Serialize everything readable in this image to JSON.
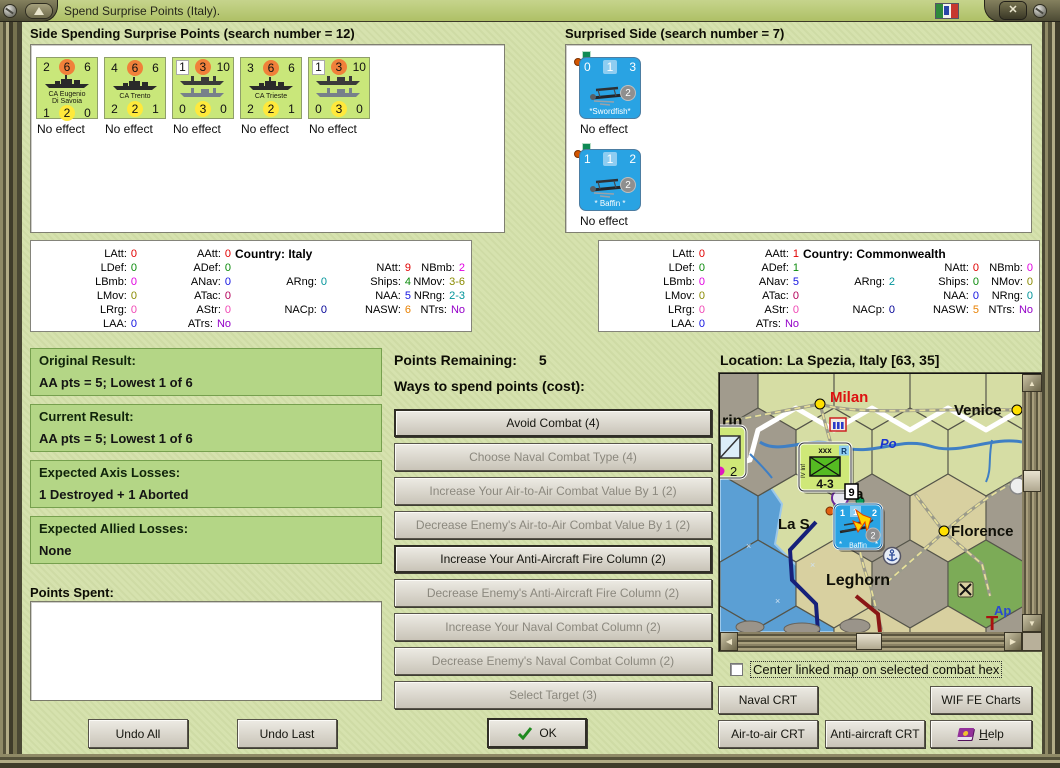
{
  "window": {
    "title": "Spend Surprise Points (Italy).",
    "close_glyph": "✕",
    "flag": "italy-flag"
  },
  "left_panel": {
    "heading": "Side Spending Surprise Points (search number = 12)",
    "units": [
      {
        "type": "ship",
        "name1": "CA Eugenio",
        "name2": "Di Savoia",
        "t1": "2",
        "t2": "6",
        "t3": "6",
        "b1": "1",
        "b2": "2",
        "b3": "0",
        "t1box": false,
        "effect": "No effect"
      },
      {
        "type": "ship",
        "name1": "CA Trento",
        "name2": "",
        "t1": "4",
        "t2": "6",
        "t3": "6",
        "b1": "2",
        "b2": "2",
        "b3": "1",
        "t1box": false,
        "effect": "No effect"
      },
      {
        "type": "convoy",
        "name1": "",
        "name2": "",
        "t1": "1",
        "t2": "3",
        "t3": "10",
        "b1": "0",
        "b2": "3",
        "b3": "0",
        "t1box": true,
        "effect": "No effect"
      },
      {
        "type": "ship",
        "name1": "CA Trieste",
        "name2": "",
        "t1": "3",
        "t2": "6",
        "t3": "6",
        "b1": "2",
        "b2": "2",
        "b3": "1",
        "t1box": false,
        "effect": "No effect"
      },
      {
        "type": "convoy",
        "name1": "",
        "name2": "",
        "t1": "1",
        "t2": "3",
        "t3": "10",
        "b1": "0",
        "b2": "3",
        "b3": "0",
        "t1box": true,
        "effect": "No effect"
      }
    ]
  },
  "right_panel": {
    "heading": "Surprised Side (search number = 7)",
    "units": [
      {
        "name": "*Swordfish*",
        "t1": "0",
        "t2": "1",
        "t3": "3",
        "circle": "2",
        "effect": "No effect"
      },
      {
        "name": "* Baffin *",
        "t1": "1",
        "t2": "1",
        "t3": "2",
        "circle": "2",
        "effect": "No effect"
      }
    ]
  },
  "stats_left": {
    "country": "Country: Italy",
    "land": [
      [
        "LAtt",
        "0",
        "red"
      ],
      [
        "LDef",
        "0",
        "green"
      ],
      [
        "LBmb",
        "0",
        "magenta"
      ],
      [
        "LMov",
        "0",
        "olive"
      ],
      [
        "LRrg",
        "0",
        "pink"
      ],
      [
        "LAA",
        "0",
        "blue"
      ]
    ],
    "air": [
      [
        "AAtt",
        "0",
        "red"
      ],
      [
        "ADef",
        "0",
        "green"
      ],
      [
        "ANav",
        "0",
        "blue"
      ],
      [
        "ATac",
        "0",
        "maroon"
      ],
      [
        "AStr",
        "0",
        "pink"
      ],
      [
        "ATrs",
        "No",
        "purple"
      ]
    ],
    "mid": [
      [
        "ARng",
        "0",
        "teal"
      ],
      [
        "NACp",
        "0",
        "navy"
      ]
    ],
    "nav1": [
      [
        "NAtt",
        "9",
        "red"
      ],
      [
        "Ships",
        "4",
        "green"
      ],
      [
        "NAA",
        "5",
        "blue"
      ],
      [
        "NASW",
        "6",
        "orange"
      ]
    ],
    "nav2": [
      [
        "NBmb",
        "2",
        "magenta"
      ],
      [
        "NMov",
        "3-6",
        "olive"
      ],
      [
        "NRng",
        "2-3",
        "teal"
      ],
      [
        "NTrs",
        "No",
        "purple"
      ]
    ]
  },
  "stats_right": {
    "country": "Country: Commonwealth",
    "land": [
      [
        "LAtt",
        "0",
        "red"
      ],
      [
        "LDef",
        "0",
        "green"
      ],
      [
        "LBmb",
        "0",
        "magenta"
      ],
      [
        "LMov",
        "0",
        "olive"
      ],
      [
        "LRrg",
        "0",
        "pink"
      ],
      [
        "LAA",
        "0",
        "blue"
      ]
    ],
    "air": [
      [
        "AAtt",
        "1",
        "red"
      ],
      [
        "ADef",
        "1",
        "green"
      ],
      [
        "ANav",
        "5",
        "blue"
      ],
      [
        "ATac",
        "0",
        "maroon"
      ],
      [
        "AStr",
        "0",
        "pink"
      ],
      [
        "ATrs",
        "No",
        "purple"
      ]
    ],
    "mid": [
      [
        "ARng",
        "2",
        "teal"
      ],
      [
        "NACp",
        "0",
        "navy"
      ]
    ],
    "nav1": [
      [
        "NAtt",
        "0",
        "red"
      ],
      [
        "Ships",
        "0",
        "green"
      ],
      [
        "NAA",
        "0",
        "blue"
      ],
      [
        "NASW",
        "5",
        "orange"
      ]
    ],
    "nav2": [
      [
        "NBmb",
        "0",
        "magenta"
      ],
      [
        "NMov",
        "0",
        "olive"
      ],
      [
        "NRng",
        "0",
        "teal"
      ],
      [
        "NTrs",
        "No",
        "purple"
      ]
    ]
  },
  "results": [
    {
      "title": "Original Result:",
      "value": "AA pts = 5; Lowest 1 of 6"
    },
    {
      "title": "Current Result:",
      "value": "AA pts = 5; Lowest 1 of 6"
    },
    {
      "title": "Expected Axis Losses:",
      "value": "1 Destroyed + 1 Aborted"
    },
    {
      "title": "Expected Allied Losses:",
      "value": "None"
    }
  ],
  "points_spent_label": "Points Spent:",
  "undo_all": "Undo All",
  "undo_last": "Undo Last",
  "spend": {
    "remaining_label": "Points Remaining:",
    "remaining_value": "5",
    "ways_label": "Ways to spend points (cost):",
    "buttons": [
      {
        "label": "Avoid Combat (4)",
        "enabled": true
      },
      {
        "label": "Choose Naval Combat Type (4)",
        "enabled": false
      },
      {
        "label": "Increase Your Air-to-Air Combat Value By 1 (2)",
        "enabled": false
      },
      {
        "label": "Decrease Enemy's Air-to-Air Combat Value By 1 (2)",
        "enabled": false
      },
      {
        "label": "Increase Your Anti-Aircraft Fire Column (2)",
        "enabled": true
      },
      {
        "label": "Decrease Enemy's Anti-Aircraft Fire Column (2)",
        "enabled": false
      },
      {
        "label": "Increase Your Naval Combat Column (2)",
        "enabled": false
      },
      {
        "label": "Decrease Enemy's Naval Combat Column (2)",
        "enabled": false
      },
      {
        "label": "Select Target (3)",
        "enabled": false
      }
    ]
  },
  "ok_label": "OK",
  "map": {
    "location": "Location: La Spezia, Italy [63, 35]",
    "labels": {
      "turin": "rin",
      "milan": "Milan",
      "venice": "Venice",
      "po": "Po",
      "genoa": "oa",
      "la_spezia": "La S",
      "leghorn": "Leghorn",
      "florence": "Florence",
      "apennines": "Ap",
      "t": "T",
      "nine": "9",
      "two": "2"
    },
    "army_counter": {
      "top": "xxx",
      "corner": "R",
      "side": "IV Inf",
      "value": "4-3"
    },
    "air_counter": {
      "t1": "1",
      "t2": "1",
      "t3": "2",
      "circle": "2",
      "name": "Baffin",
      "star": "*"
    },
    "checkbox_label": "Center linked map on selected combat hex",
    "checked": false
  },
  "bottom_buttons": {
    "naval": "Naval CRT",
    "wif": "WIF FE Charts",
    "a2a": "Air-to-air CRT",
    "aa": "Anti-aircraft CRT",
    "help_u": "H",
    "help_rest": "elp"
  },
  "colors": {
    "titlebar": "#b9cc7d",
    "dialog_bg": "#d6e2ae",
    "result_box": "#b4d686",
    "counter_green": "#c9e77a",
    "counter_blue": "#29a3e3",
    "orange_circle": "#f0803a",
    "yellow_circle": "#ffe93c",
    "milan_red": "#dd1111",
    "sea_blue": "#5b9fd4"
  }
}
